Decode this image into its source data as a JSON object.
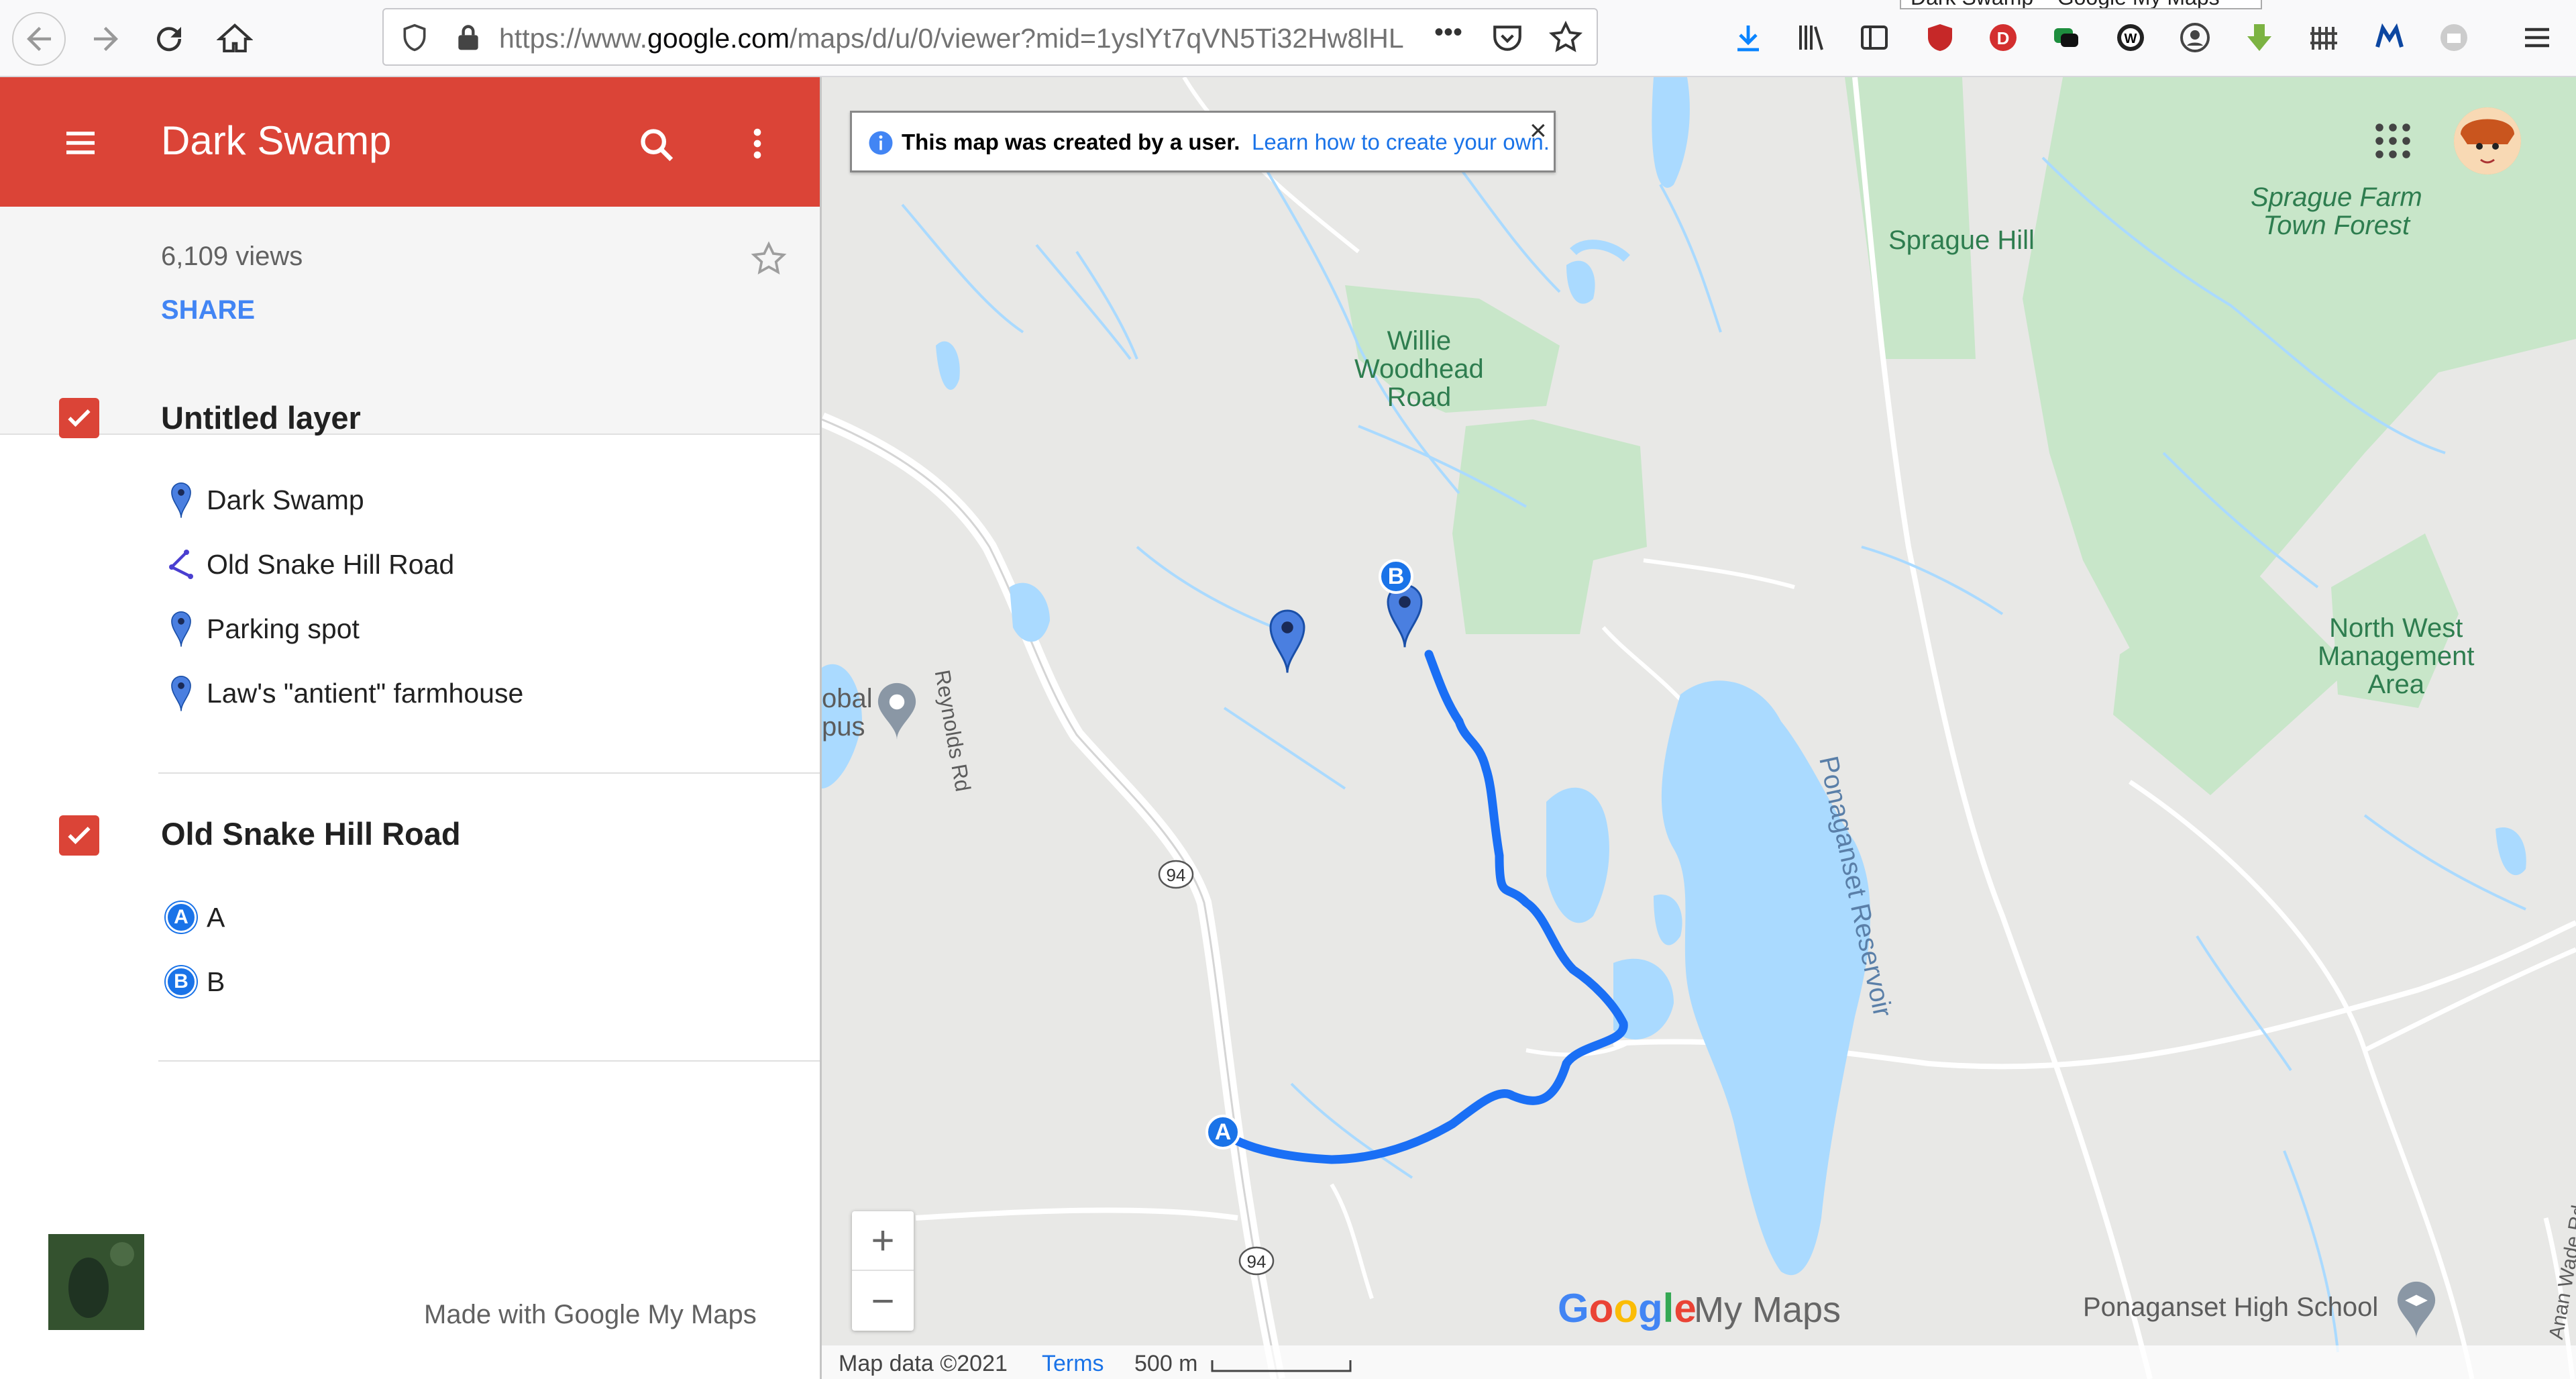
{
  "browser": {
    "url_prefix": "https://www.",
    "url_domain": "google.com",
    "url_path": "/maps/d/u/0/viewer?mid=1yslYt7qVN5Ti32Hw8lHL",
    "more_glyph": "•••",
    "tab_tooltip": "Dark Swamp – Google My Maps"
  },
  "sidebar": {
    "title": "Dark Swamp",
    "views": "6,109 views",
    "share": "SHARE",
    "layers": [
      {
        "title": "Untitled layer",
        "items": [
          {
            "label": "Dark Swamp",
            "icon": "blue-pin-icon"
          },
          {
            "label": "Old Snake Hill Road",
            "icon": "line-path-icon"
          },
          {
            "label": "Parking spot",
            "icon": "blue-pin-icon"
          },
          {
            "label": "Law's \"antient\" farmhouse",
            "icon": "blue-pin-icon"
          }
        ]
      },
      {
        "title": "Old Snake Hill Road",
        "items": [
          {
            "label": "A",
            "marker": "A"
          },
          {
            "label": "B",
            "marker": "B"
          }
        ]
      }
    ],
    "made_with": "Made with Google My Maps"
  },
  "map": {
    "notice_text": "This map was created by a user.",
    "notice_link": "Learn how to create your own.",
    "notice_close": "×",
    "labels": {
      "sprague_hill": "Sprague Hill",
      "sprague_forest_1": "Sprague Farm",
      "sprague_forest_2": "Town Forest",
      "willie_1": "Willie",
      "willie_2": "Woodhead",
      "willie_3": "Road",
      "nw_1": "North West",
      "nw_2": "Management",
      "nw_3": "Area",
      "reynolds": "Reynolds Rd",
      "reservoir": "Ponaganset Reservoir",
      "high_school": "Ponaganset High School",
      "anan": "Anan Wade Rd",
      "campus": "obal\npus",
      "route94": "94"
    },
    "route_markers": {
      "a": "A",
      "b": "B"
    },
    "zoom_in": "+",
    "zoom_out": "−",
    "footer": {
      "map_data": "Map data ©2021",
      "terms": "Terms",
      "scale": "500 m"
    },
    "logo_google": [
      "G",
      "o",
      "o",
      "g",
      "l",
      "e"
    ],
    "logo_suffix": "My Maps",
    "colors": {
      "header_red": "#db4437",
      "route_blue": "#1a73e8",
      "water": "#aadaff",
      "park_green": "#c8e6c9",
      "land": "#e8e8e6"
    }
  }
}
